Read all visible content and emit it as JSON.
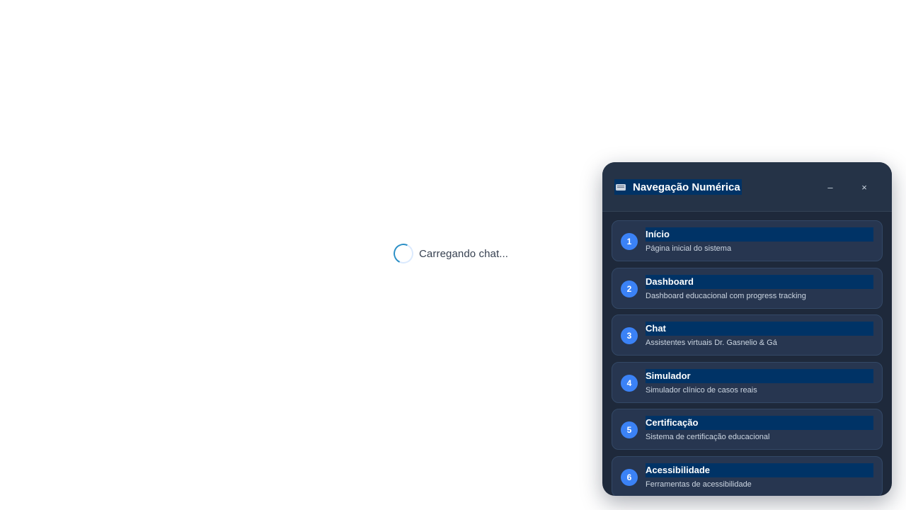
{
  "loading": {
    "text": "Carregando chat..."
  },
  "nav_panel": {
    "title": "Navegação Numérica",
    "icon": "keyboard-icon",
    "minimize_label": "–",
    "close_label": "×",
    "items": [
      {
        "number": "1",
        "label": "Início",
        "description": "Página inicial do sistema"
      },
      {
        "number": "2",
        "label": "Dashboard",
        "description": "Dashboard educacional com progress tracking"
      },
      {
        "number": "3",
        "label": "Chat",
        "description": "Assistentes virtuais Dr. Gasnelio & Gá"
      },
      {
        "number": "4",
        "label": "Simulador",
        "description": "Simulador clínico de casos reais"
      },
      {
        "number": "5",
        "label": "Certificação",
        "description": "Sistema de certificação educacional"
      },
      {
        "number": "6",
        "label": "Acessibilidade",
        "description": "Ferramentas de acessibilidade"
      }
    ]
  },
  "colors": {
    "panel_bg": "#1e293b",
    "item_bg": "#273650",
    "badge": "#3b82f6",
    "highlight": "#003366",
    "spinner": "#2b8fc6"
  }
}
